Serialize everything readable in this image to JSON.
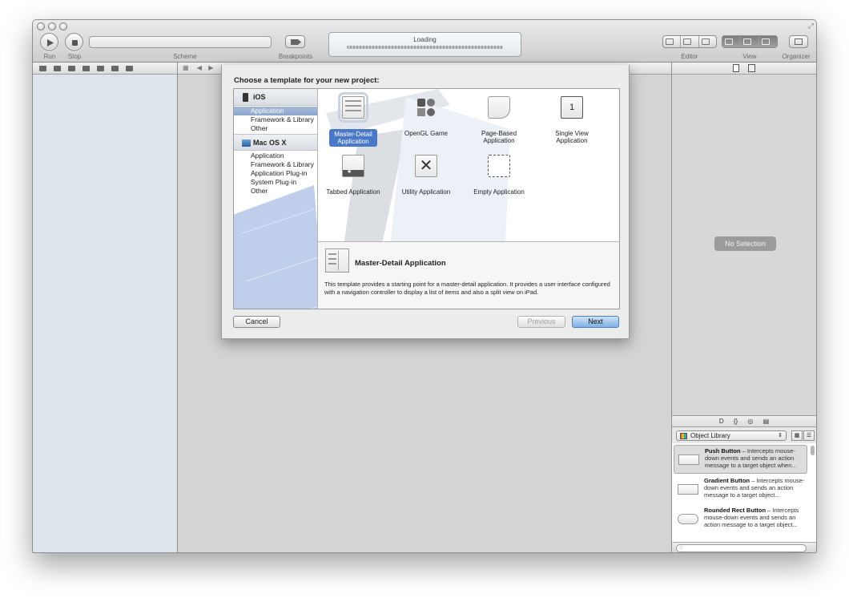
{
  "toolbar": {
    "run_label": "Run",
    "stop_label": "Stop",
    "scheme_label": "Scheme",
    "breakpoints_label": "Breakpoints",
    "activity_text": "Loading",
    "editor_label": "Editor",
    "view_label": "View",
    "organizer_label": "Organizer"
  },
  "dialog": {
    "title": "Choose a template for your new project:",
    "categories": [
      {
        "heading": "iOS",
        "items": [
          "Application",
          "Framework & Library",
          "Other"
        ]
      },
      {
        "heading": "Mac OS X",
        "items": [
          "Application",
          "Framework & Library",
          "Application Plug-in",
          "System Plug-in",
          "Other"
        ]
      }
    ],
    "templates": [
      {
        "label": "Master-Detail Application",
        "icon": "master-detail-icon",
        "selected": true
      },
      {
        "label": "OpenGL Game",
        "icon": "opengl-game-icon",
        "selected": false
      },
      {
        "label": "Page-Based Application",
        "icon": "page-based-icon",
        "selected": false
      },
      {
        "label": "Single View Application",
        "icon": "single-view-icon",
        "selected": false
      },
      {
        "label": "Tabbed Application",
        "icon": "tabbed-icon",
        "selected": false
      },
      {
        "label": "Utility Application",
        "icon": "utility-icon",
        "selected": false
      },
      {
        "label": "Empty Application",
        "icon": "empty-app-icon",
        "selected": false
      }
    ],
    "single_view_glyph": "1",
    "description": {
      "title": "Master-Detail Application",
      "text": "This template provides a starting point for a master-detail application. It provides a user interface configured with a navigation controller to display a list of items and also a split view on iPad."
    },
    "buttons": {
      "cancel": "Cancel",
      "previous": "Previous",
      "next": "Next"
    }
  },
  "utilities": {
    "no_selection": "No Selection",
    "library_select": "Object Library",
    "library_tabs": [
      "D",
      "{}",
      "◎",
      "▤"
    ],
    "library_items": [
      {
        "name": "Push Button",
        "desc": " – Intercepts mouse-down events and sends an action message to a target object when..."
      },
      {
        "name": "Gradient Button",
        "desc": " – Intercepts mouse-down events and sends an action message to a target object..."
      },
      {
        "name": "Rounded Rect Button",
        "desc": " – Intercepts mouse-down events and sends an action message to a target object..."
      }
    ]
  },
  "colors": {
    "selection_blue": "#4a78c9",
    "next_button": "#7fb0e6"
  }
}
